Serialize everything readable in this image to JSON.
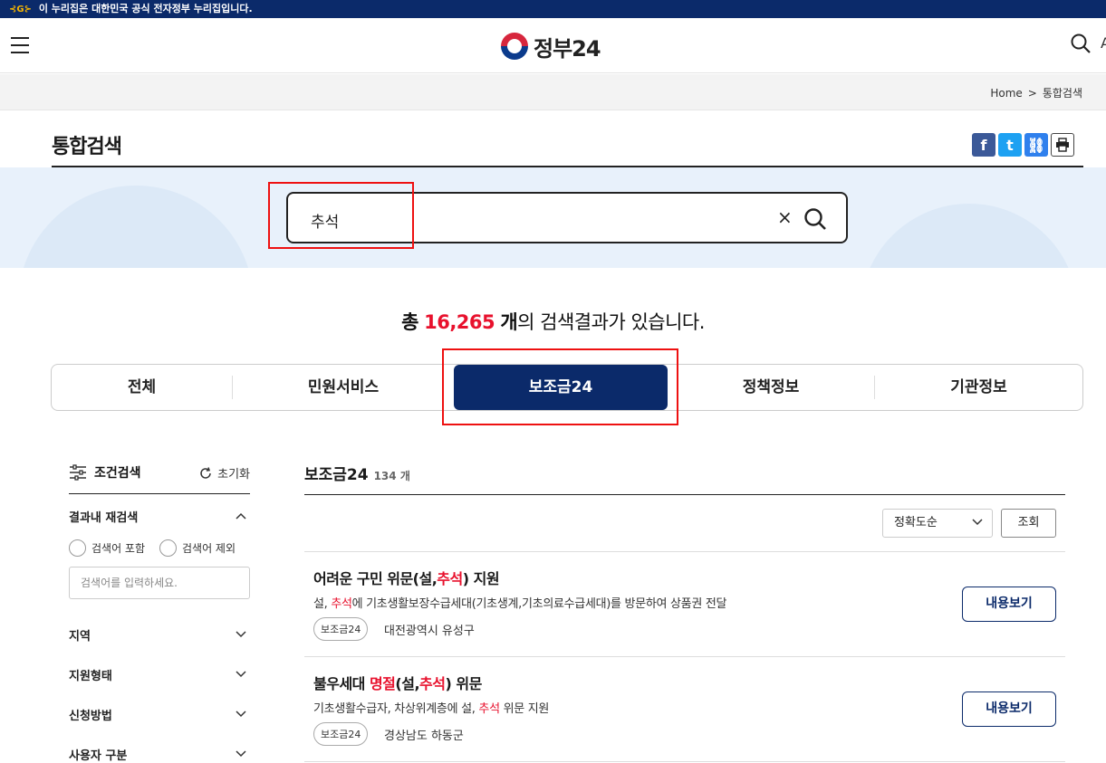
{
  "banner": {
    "text": "이 누리집은 대한민국 공식 전자정부 누리집입니다."
  },
  "header": {
    "logo_text": "정부24",
    "extra_glyph": "A"
  },
  "breadcrumb": {
    "home": "Home",
    "sep": ">",
    "current": "통합검색"
  },
  "page": {
    "title": "통합검색"
  },
  "share": {
    "facebook": "f",
    "twitter": "t",
    "link": "⛓",
    "print": "⎙"
  },
  "search": {
    "value": "추석",
    "clear": "×"
  },
  "results": {
    "prefix": "총",
    "count": "16,265",
    "unit": "개",
    "suffix": "의 검색결과가 있습니다."
  },
  "tabs": [
    {
      "label": "전체"
    },
    {
      "label": "민원서비스"
    },
    {
      "label": "보조금24",
      "active": true
    },
    {
      "label": "정책정보"
    },
    {
      "label": "기관정보"
    }
  ],
  "filter": {
    "title": "조건검색",
    "reset": "초기화",
    "refine": "결과내 재검색",
    "include": "검색어 포함",
    "exclude": "검색어 제외",
    "input_placeholder": "검색어를 입력하세요.",
    "sections": [
      "지역",
      "지원형태",
      "신청방법",
      "사용자 구분"
    ]
  },
  "main": {
    "title": "보조금24",
    "count": "134",
    "count_unit": "개",
    "sort": "정확도순",
    "query_btn": "조회",
    "items": [
      {
        "title_a": "어려운 구민 위문(설,",
        "title_hl": "추석",
        "title_b": ") 지원",
        "desc_a": "설, ",
        "desc_hl": "추석",
        "desc_b": "에 기초생활보장수급세대(기초생계,기초의료수급세대)를 방문하여 상품권 전달",
        "tag": "보조금24",
        "region": "대전광역시 유성구",
        "button": "내용보기"
      },
      {
        "title_a": "불우세대 ",
        "title_hl1": "명절",
        "title_b": "(설,",
        "title_hl2": "추석",
        "title_c": ") 위문",
        "desc_a": "기초생활수급자, 차상위계층에 설, ",
        "desc_hl": "추석",
        "desc_b": " 위문 지원",
        "tag": "보조금24",
        "region": "경상남도 하동군",
        "button": "내용보기"
      }
    ]
  },
  "colors": {
    "navy": "#0b2a6a",
    "highlight_red": "#e8112d"
  }
}
